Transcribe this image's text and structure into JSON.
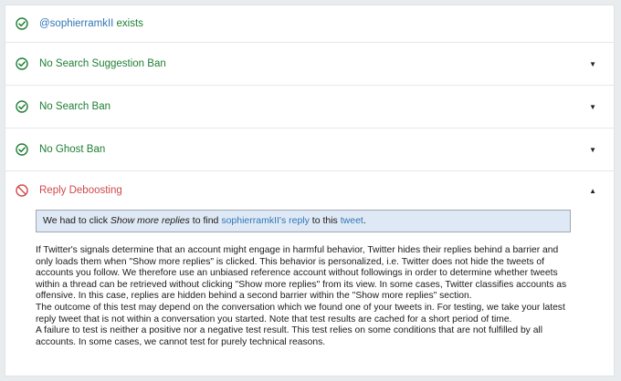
{
  "colors": {
    "ok": "#1e7e34",
    "bad": "#d04a4a",
    "link": "#2f76b7"
  },
  "checks": [
    {
      "icon": "check-circle-icon",
      "status": "ok",
      "handle": "@sophierramkII",
      "suffix": " exists"
    },
    {
      "icon": "check-circle-icon",
      "status": "ok",
      "label": "No Search Suggestion Ban",
      "chevron": "▼"
    },
    {
      "icon": "check-circle-icon",
      "status": "ok",
      "label": "No Search Ban",
      "chevron": "▼"
    },
    {
      "icon": "check-circle-icon",
      "status": "ok",
      "label": "No Ghost Ban",
      "chevron": "▼"
    },
    {
      "icon": "ban-circle-icon",
      "status": "bad",
      "label": "Reply Deboosting",
      "chevron": "▲"
    }
  ],
  "notice": {
    "prefix": "We had to click ",
    "emphasis": "Show more replies",
    "middle": " to find ",
    "reply_link": "sophierramkII's reply",
    "between": " to this ",
    "tweet_link": "tweet",
    "end": "."
  },
  "description": [
    "If Twitter's signals determine that an account might engage in harmful behavior, Twitter hides their replies behind a barrier and only loads them when \"Show more replies\" is clicked. This behavior is personalized, i.e. Twitter does not hide the tweets of accounts you follow. We therefore use an unbiased reference account without followings in order to determine whether tweets within a thread can be retrieved without clicking \"Show more replies\" from its view. In some cases, Twitter classifies accounts as offensive. In this case, replies are hidden behind a second barrier within the \"Show more replies\" section.",
    "The outcome of this test may depend on the conversation which we found one of your tweets in. For testing, we take your latest reply tweet that is not within a conversation you started. Note that test results are cached for a short period of time.",
    "A failure to test is neither a positive nor a negative test result. This test relies on some conditions that are not fulfilled by all accounts. In some cases, we cannot test for purely technical reasons."
  ]
}
